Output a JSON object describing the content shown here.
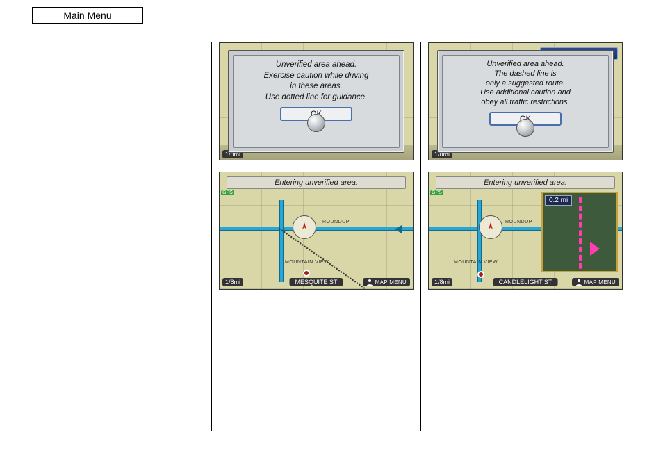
{
  "header": {
    "button_label": "Main Menu"
  },
  "shots": {
    "top_left": {
      "dialog_text": "Unverified area ahead.\nExercise caution while driving\nin these areas.\nUse dotted line for guidance.",
      "ok_label": "OK",
      "scale": "1/8mi"
    },
    "top_right": {
      "dialog_text": "Unverified area ahead.\nThe dashed line is\nonly a suggested route.\nUse additional caution and\nobey all traffic restrictions.",
      "ok_label": "OK",
      "scale": "1/8mi"
    },
    "bottom_left": {
      "banner": "Entering unverified area.",
      "scale": "1/8mi",
      "street": "MESQUITE ST",
      "mapmenu": "MAP MENU",
      "gps": "GPS",
      "label_roundup": "ROUNDUP",
      "label_mountain": "MOUNTAIN VIEW"
    },
    "bottom_right": {
      "banner": "Entering unverified area.",
      "scale": "1/8mi",
      "street": "CANDLELIGHT ST",
      "mapmenu": "MAP MENU",
      "gps": "GPS",
      "inset_distance": "0.2 mi",
      "label_roundup": "ROUNDUP",
      "label_mountain": "MOUNTAIN VIEW"
    }
  }
}
